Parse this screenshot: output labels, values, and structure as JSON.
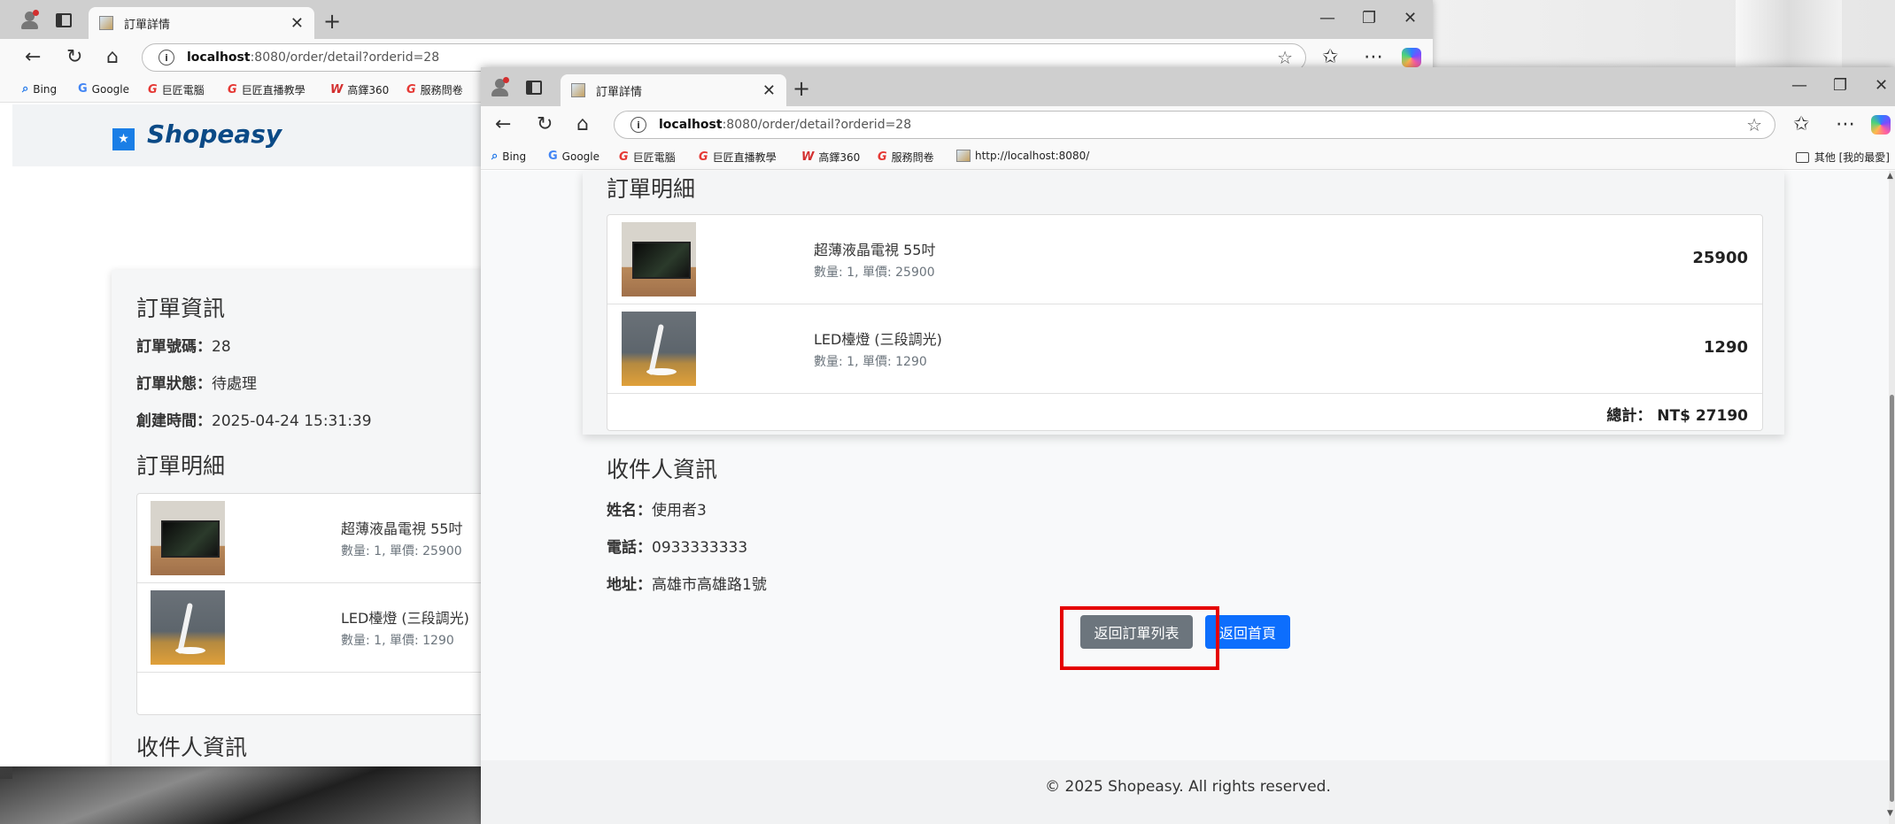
{
  "back_window": {
    "tab_title": "訂單詳情",
    "url_host": "localhost",
    "url_rest": ":8080/order/detail?orderid=28",
    "bookmarks": [
      "Bing",
      "Google",
      "巨匠電腦",
      "巨匠直播教學",
      "高鐸360",
      "服務問卷"
    ],
    "brand": "Shopeasy",
    "order_info_title": "訂單資訊",
    "order_no_label": "訂單號碼：",
    "order_no": "28",
    "status_label": "訂單狀態：",
    "status": "待處理",
    "created_label": "創建時間：",
    "created": "2025-04-24 15:31:39",
    "details_title": "訂單明細",
    "items": [
      {
        "name": "超薄液晶電視 55吋",
        "meta": "數量: 1, 單價: 25900"
      },
      {
        "name": "LED檯燈 (三段調光)",
        "meta": "數量: 1, 單價: 1290"
      }
    ],
    "recipient_title": "收件人資訊"
  },
  "front_window": {
    "tab_title": "訂單詳情",
    "url_host": "localhost",
    "url_rest": ":8080/order/detail?orderid=28",
    "bookmarks": [
      "Bing",
      "Google",
      "巨匠電腦",
      "巨匠直播教學",
      "高鐸360",
      "服務問卷",
      "http://localhost:8080/"
    ],
    "other_bookmarks": "其他 [我的最愛]",
    "details_title": "訂單明細",
    "items": [
      {
        "name": "超薄液晶電視 55吋",
        "meta": "數量: 1, 單價: 25900",
        "price": "25900"
      },
      {
        "name": "LED檯燈 (三段調光)",
        "meta": "數量: 1, 單價: 1290",
        "price": "1290"
      }
    ],
    "total_label": "總計：",
    "total": "NT$ 27190",
    "recipient_title": "收件人資訊",
    "name_label": "姓名：",
    "name": "使用者3",
    "phone_label": "電話：",
    "phone": "0933333333",
    "address_label": "地址：",
    "address": "高雄市高雄路1號",
    "btn_orders": "返回訂單列表",
    "btn_home": "返回首頁",
    "footer": "© 2025 Shopeasy. All rights reserved."
  },
  "colors": {
    "btn_secondary": "#6c757d",
    "btn_primary": "#0d6efd",
    "highlight": "#e50000",
    "brand": "#0b4a86"
  }
}
